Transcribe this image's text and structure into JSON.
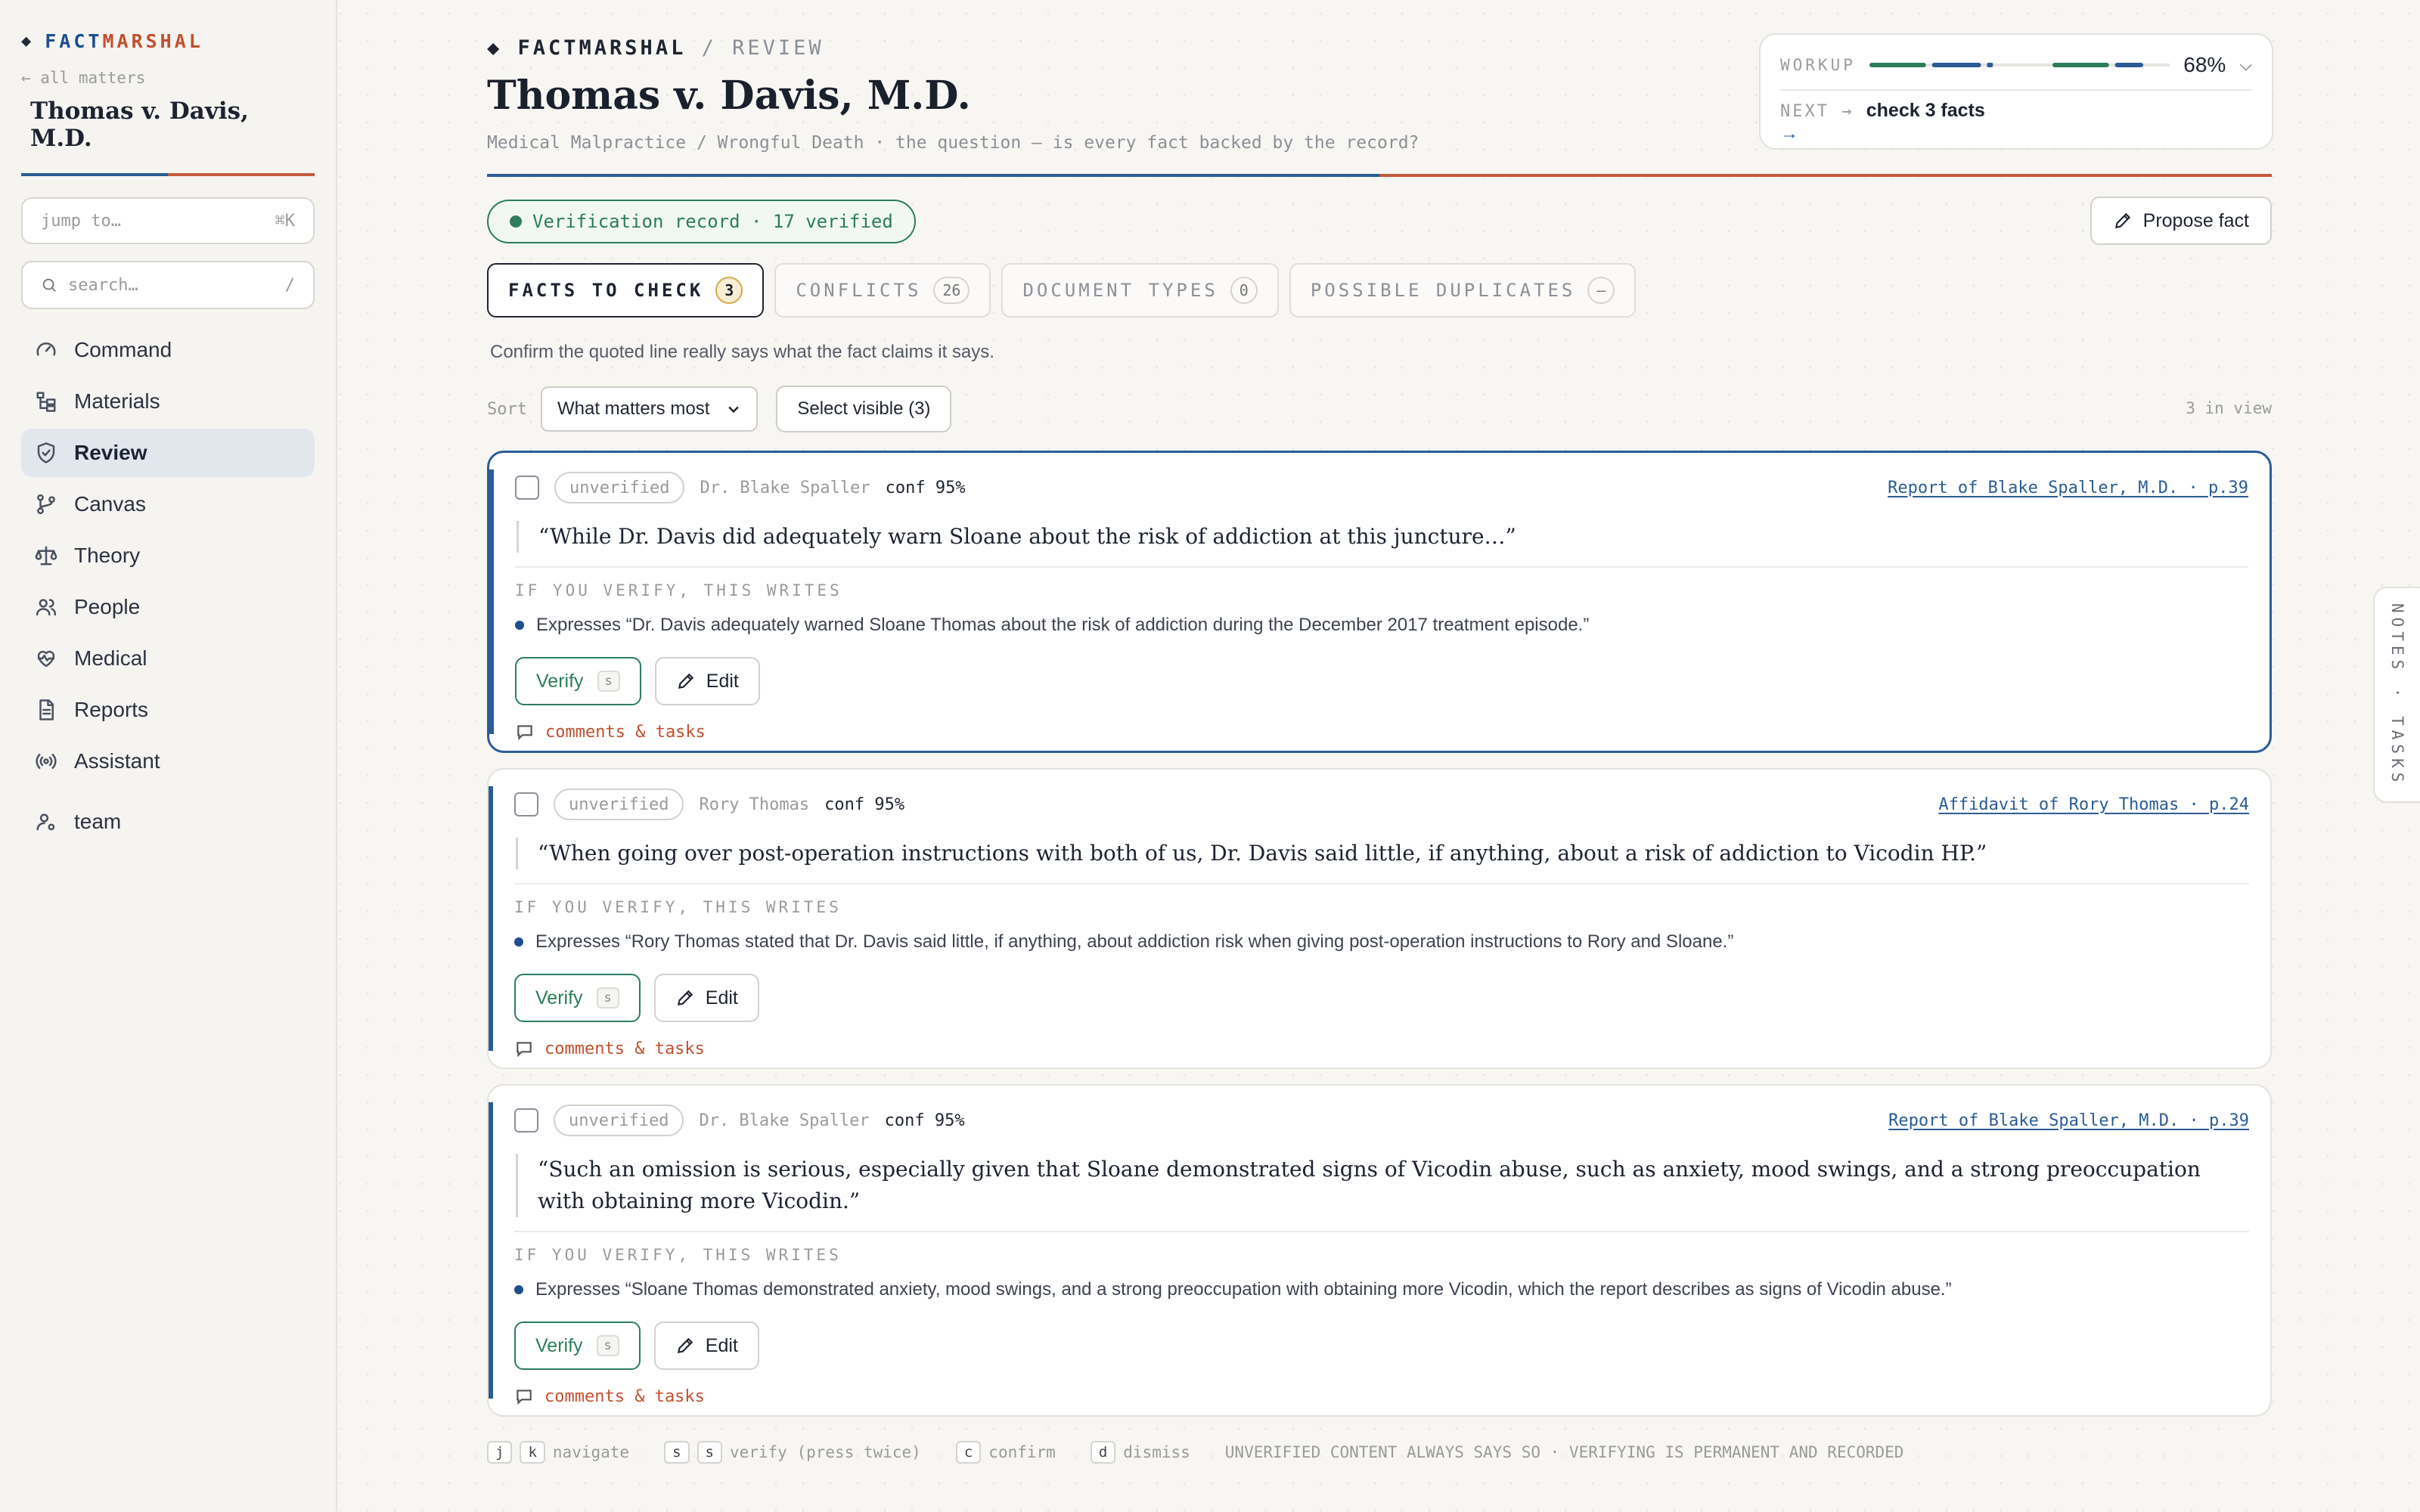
{
  "sidebar": {
    "brand_fact": "FACT",
    "brand_marshal": "MARSHAL",
    "back_link": "← all matters",
    "matter_title": "Thomas v. Davis, M.D.",
    "jump_placeholder": "jump to…",
    "jump_shortcut": "⌘K",
    "search_placeholder": "search…",
    "search_shortcut": "/",
    "items": [
      {
        "label": "Command",
        "icon": "gauge-icon"
      },
      {
        "label": "Materials",
        "icon": "folder-tree-icon"
      },
      {
        "label": "Review",
        "icon": "shield-check-icon",
        "active": true
      },
      {
        "label": "Canvas",
        "icon": "branch-icon"
      },
      {
        "label": "Theory",
        "icon": "scales-icon"
      },
      {
        "label": "People",
        "icon": "people-icon"
      },
      {
        "label": "Medical",
        "icon": "heart-pulse-icon"
      },
      {
        "label": "Reports",
        "icon": "document-icon"
      },
      {
        "label": "Assistant",
        "icon": "broadcast-icon"
      },
      {
        "label": "team",
        "icon": "user-settings-icon"
      }
    ]
  },
  "header": {
    "crumb_brand": "FACTMARSHAL",
    "crumb_sep": "/",
    "crumb_page": "REVIEW",
    "title": "Thomas v. Davis, M.D.",
    "subtitle": "Medical Malpractice / Wrongful Death · the question — is every fact backed by the record?"
  },
  "workup": {
    "label": "WORKUP",
    "percent": "68%",
    "progress": 0.68,
    "next_label": "NEXT →",
    "next_text": "check 3 facts",
    "next_arrow": "→"
  },
  "verification": {
    "label": "Verification record · 17 verified"
  },
  "propose_label": "Propose fact",
  "tabs": [
    {
      "label": "FACTS TO CHECK",
      "count": "3",
      "active": true
    },
    {
      "label": "CONFLICTS",
      "count": "26"
    },
    {
      "label": "DOCUMENT TYPES",
      "count": "0"
    },
    {
      "label": "POSSIBLE DUPLICATES",
      "count": "—"
    }
  ],
  "instructions": "Confirm the quoted line really says what the fact claims it says.",
  "sort": {
    "label": "Sort",
    "value": "What matters most",
    "select_visible": "Select visible (3)",
    "in_view": "3 in view"
  },
  "facts": [
    {
      "status": "unverified",
      "speaker": "Dr. Blake Spaller",
      "conf": "conf 95%",
      "source": "Report of Blake Spaller, M.D. · p.39",
      "quote": "“While Dr. Davis did adequately warn Sloane about the risk of addiction at this juncture…”",
      "writes_label": "IF YOU VERIFY, THIS WRITES",
      "writes": "Expresses “Dr. Davis adequately warned Sloane Thomas about the risk of addiction during the December 2017 treatment episode.”",
      "verify": "Verify",
      "verify_key": "s",
      "edit": "Edit",
      "comments": "comments & tasks"
    },
    {
      "status": "unverified",
      "speaker": "Rory Thomas",
      "conf": "conf 95%",
      "source": "Affidavit of Rory Thomas · p.24",
      "quote": "“When going over post-operation instructions with both of us, Dr. Davis said little, if anything, about a risk of addiction to Vicodin HP.”",
      "writes_label": "IF YOU VERIFY, THIS WRITES",
      "writes": "Expresses “Rory Thomas stated that Dr. Davis said little, if anything, about addiction risk when giving post-operation instructions to Rory and Sloane.”",
      "verify": "Verify",
      "verify_key": "s",
      "edit": "Edit",
      "comments": "comments & tasks"
    },
    {
      "status": "unverified",
      "speaker": "Dr. Blake Spaller",
      "conf": "conf 95%",
      "source": "Report of Blake Spaller, M.D. · p.39",
      "quote": "“Such an omission is serious, especially given that Sloane demonstrated signs of Vicodin abuse, such as anxiety, mood swings, and a strong preoccupation with obtaining more Vicodin.”",
      "writes_label": "IF YOU VERIFY, THIS WRITES",
      "writes": "Expresses “Sloane Thomas demonstrated anxiety, mood swings, and a strong preoccupation with obtaining more Vicodin, which the report describes as signs of Vicodin abuse.”",
      "verify": "Verify",
      "verify_key": "s",
      "edit": "Edit",
      "comments": "comments & tasks"
    }
  ],
  "hints": {
    "k1": "j",
    "k2": "k",
    "navigate": "navigate",
    "k3": "s",
    "k4": "s",
    "verify": "verify (press twice)",
    "k5": "c",
    "confirm": "confirm",
    "k6": "d",
    "dismiss": "dismiss",
    "notice": "UNVERIFIED CONTENT ALWAYS SAYS SO · VERIFYING IS PERMANENT AND RECORDED"
  },
  "notes_tab": "NOTES · TASKS",
  "colors": {
    "accent_blue": "#2b5c95",
    "accent_rust": "#c2502e",
    "verify_green": "#2c7d5c"
  }
}
